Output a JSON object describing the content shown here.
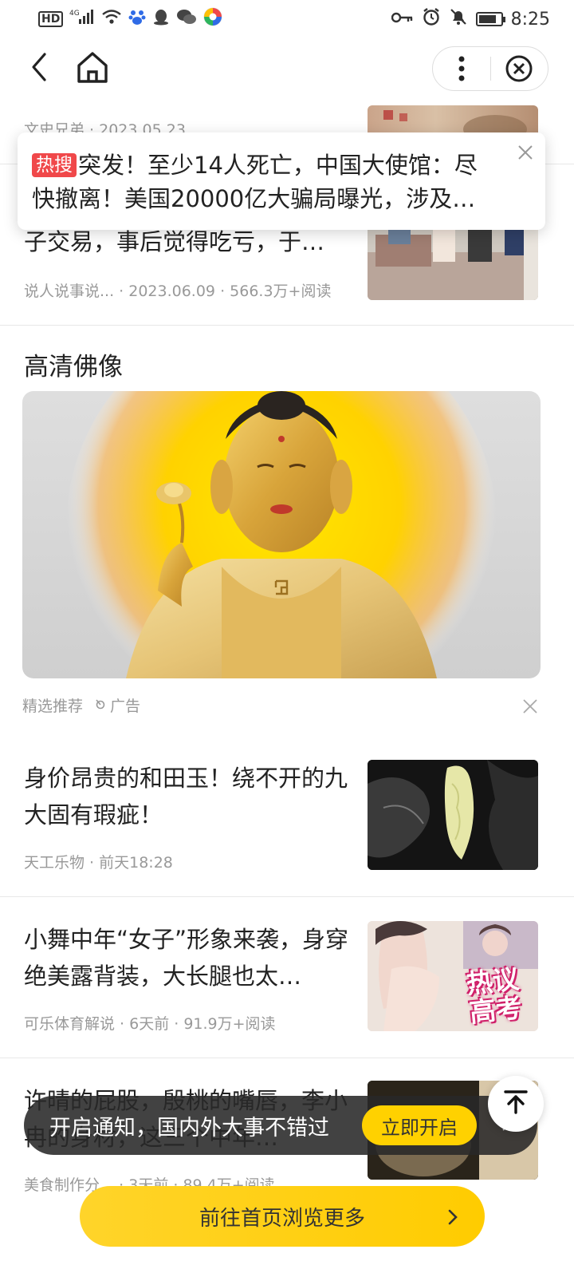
{
  "status_bar": {
    "hd_tag": "HD",
    "network": "4G",
    "time": "8:25",
    "battery_level": 0.8,
    "left_icons": [
      "signal-icon",
      "wifi-icon",
      "baidu-paw-icon",
      "qq-icon",
      "wechat-icon",
      "app-icon"
    ],
    "right_icons": [
      "key-icon",
      "alarm-icon",
      "bell-muted-icon",
      "battery-icon"
    ]
  },
  "nav": {
    "icons": [
      "back-arrow-icon",
      "home-icon",
      "more-vertical-icon",
      "close-circle-icon"
    ]
  },
  "hot_popup": {
    "badge": "热搜",
    "text": "突发！至少14人死亡，中国大使馆：尽快撤离！美国20000亿大骗局曝光，涉及新…"
  },
  "articles": [
    {
      "title": "",
      "meta": "文史兄弟 · 2023.05.23"
    },
    {
      "title": "子交易，事后觉得吃亏，于…",
      "meta": "说人说事说... · 2023.06.09 · 566.3万+阅读"
    },
    {
      "title": "身价昂贵的和田玉！绕不开的九大固有瑕疵！",
      "meta": "天工乐物 · 前天18:28"
    },
    {
      "title": "小舞中年“女子”形象来袭，身穿绝美露背装，大长腿也太…",
      "meta": "可乐体育解说 · 6天前 · 91.9万+阅读",
      "thumb_overlay": "热议高考"
    },
    {
      "title": "许晴的屁股，殷桃的嘴唇，李小冉的身材，这三个中年…",
      "meta": "美食制作分... · 3天前 · 89.4万+阅读"
    }
  ],
  "ad": {
    "title": "高清佛像",
    "label": "精选推荐",
    "ad_tag": "广告"
  },
  "notification": {
    "text": "开启通知，国内外大事不错过",
    "button": "立即开启"
  },
  "bottom_button": {
    "label": "前往首页浏览更多"
  },
  "colors": {
    "accent_yellow": "#ffd100",
    "hot_red": "#f0484a",
    "meta_gray": "#999999"
  }
}
